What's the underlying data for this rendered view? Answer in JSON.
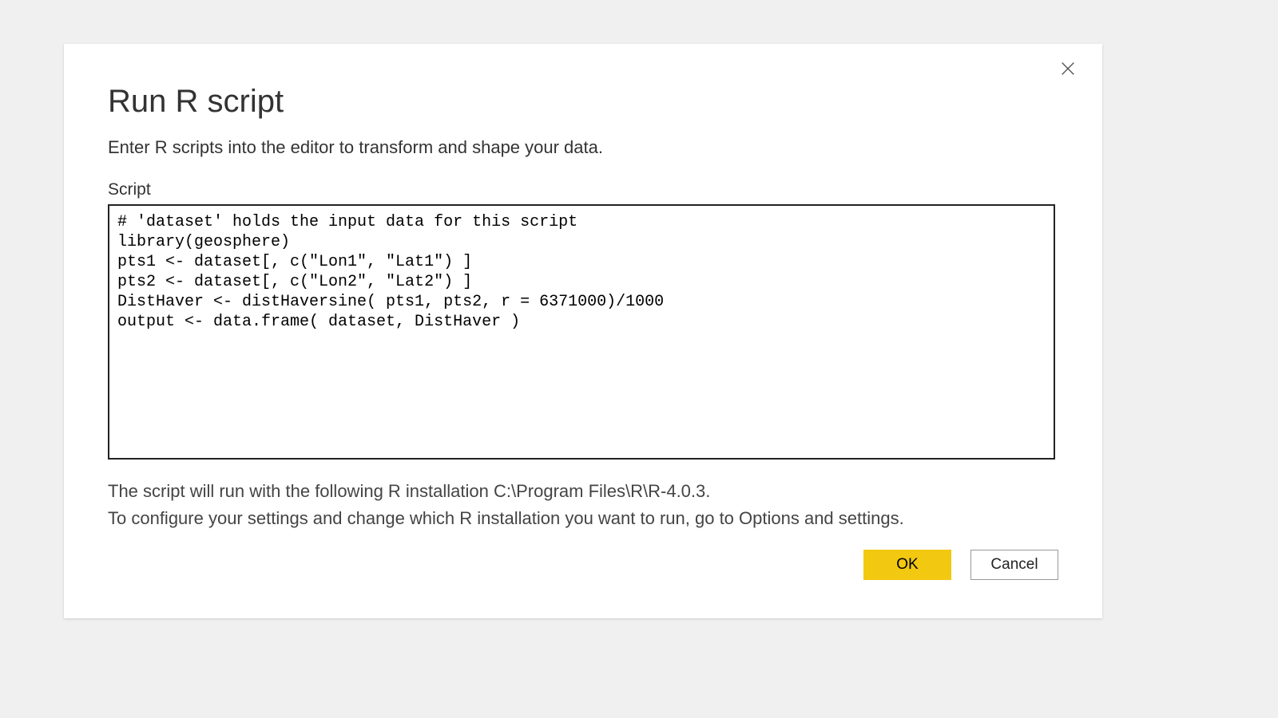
{
  "dialog": {
    "title": "Run R script",
    "subtitle": "Enter R scripts into the editor to transform and shape your data.",
    "field_label": "Script",
    "script_content": "# 'dataset' holds the input data for this script\nlibrary(geosphere)\npts1 <- dataset[, c(\"Lon1\", \"Lat1\") ]\npts2 <- dataset[, c(\"Lon2\", \"Lat2\") ]\nDistHaver <- distHaversine( pts1, pts2, r = 6371000)/1000\noutput <- data.frame( dataset, DistHaver )",
    "info_line1": "The script will run with the following R installation C:\\Program Files\\R\\R-4.0.3.",
    "info_line2": "To configure your settings and change which R installation you want to run, go to Options and settings.",
    "ok_label": "OK",
    "cancel_label": "Cancel"
  }
}
